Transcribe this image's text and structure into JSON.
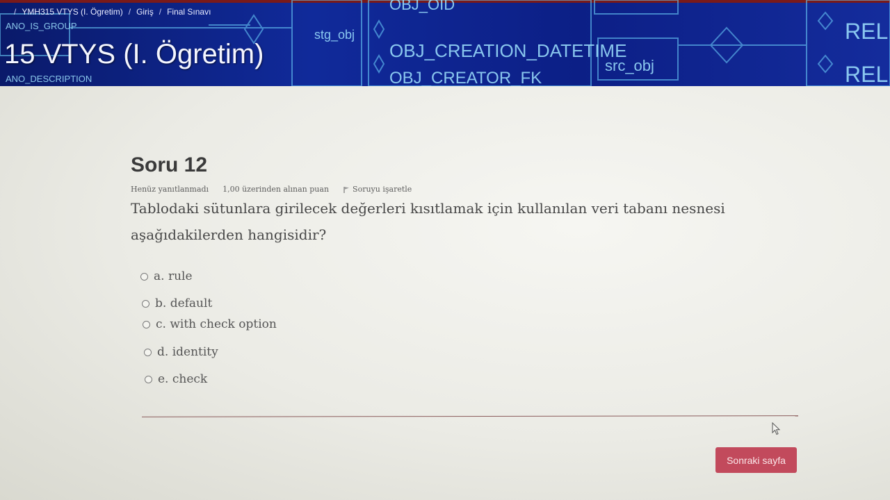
{
  "breadcrumb": {
    "items": [
      "YMH315 VTYS (I. Ögretim)",
      "Giriş",
      "Final Sınavı"
    ],
    "separator": "/"
  },
  "course": {
    "title": "15 VTYS (I. Ögretim)"
  },
  "banner_background": {
    "erd_labels": [
      "ANO_IS_GROUP",
      "ANO_DESCRIPTION",
      "stg_obj",
      "OBJ_OID",
      "OBJ_CREATION_DATETIME",
      "OBJ_CREATOR_FK",
      "src_obj",
      "REL",
      "REL"
    ]
  },
  "question": {
    "title": "Soru 12",
    "status": "Henüz yanıtlanmadı",
    "points": "1,00 üzerinden alınan puan",
    "flag_label": "Soruyu işaretle",
    "text": "Tablodaki sütunlara girilecek değerleri kısıtlamak için kullanılan veri tabanı nesnesi aşağıdakilerden hangisidir?",
    "options": [
      {
        "label": "a. rule"
      },
      {
        "label": "b. default"
      },
      {
        "label": "c. with check option"
      },
      {
        "label": "d. identity"
      },
      {
        "label": "e. check"
      }
    ],
    "selected": null
  },
  "navigation": {
    "next_label": "Sonraki sayfa"
  },
  "colors": {
    "banner": "#102a9a",
    "button": "#c24a5c",
    "divider": "#8a5b5b"
  },
  "icons": [
    "flag-icon",
    "radio-icon",
    "mouse-pointer-icon"
  ]
}
